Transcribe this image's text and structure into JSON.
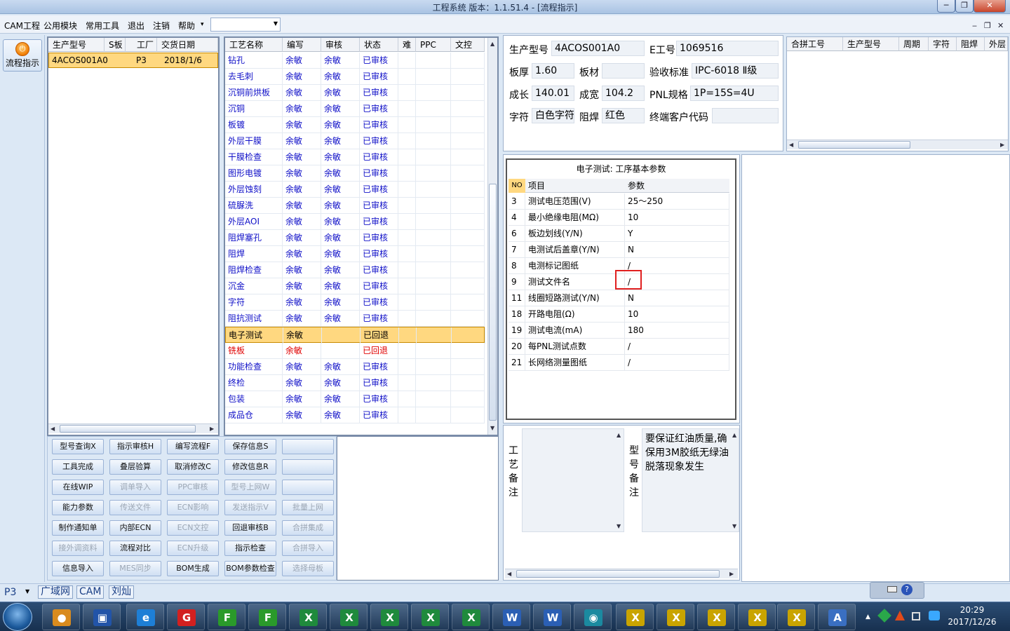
{
  "window": {
    "title": "工程系统   版本：1.1.51.4 - [流程指示]",
    "min_btn": "─",
    "max_btn": "❐",
    "close_btn": "✕"
  },
  "menu": {
    "items": [
      "CAM工程",
      "公用模块",
      "常用工具",
      "退出",
      "注销",
      "帮助"
    ],
    "help_arrow": "▾",
    "combo_value": "",
    "mdi_min": "‒",
    "mdi_restore": "❐",
    "mdi_close": "✕"
  },
  "left_toolbar": {
    "flow_button": "流程指示",
    "flow_icon": "power-icon"
  },
  "order_list": {
    "headers": [
      "生产型号",
      "S板",
      "工厂",
      "交货日期"
    ],
    "rows": [
      {
        "model": "4ACOS001A0",
        "s": "",
        "factory": "P3",
        "date": "2018/1/6"
      }
    ]
  },
  "process_table": {
    "headers": [
      "工艺名称",
      "编写",
      "审核",
      "状态",
      "难",
      "PPC",
      "文控"
    ],
    "rows": [
      {
        "name": "钻孔",
        "writer": "余敏",
        "reviewer": "余敏",
        "status": "已审核"
      },
      {
        "name": "去毛刺",
        "writer": "余敏",
        "reviewer": "余敏",
        "status": "已审核"
      },
      {
        "name": "沉铜前烘板",
        "writer": "余敏",
        "reviewer": "余敏",
        "status": "已审核"
      },
      {
        "name": "沉铜",
        "writer": "余敏",
        "reviewer": "余敏",
        "status": "已审核"
      },
      {
        "name": "板镀",
        "writer": "余敏",
        "reviewer": "余敏",
        "status": "已审核"
      },
      {
        "name": "外层干膜",
        "writer": "余敏",
        "reviewer": "余敏",
        "status": "已审核"
      },
      {
        "name": "干膜检查",
        "writer": "余敏",
        "reviewer": "余敏",
        "status": "已审核"
      },
      {
        "name": "图形电镀",
        "writer": "余敏",
        "reviewer": "余敏",
        "status": "已审核"
      },
      {
        "name": "外层蚀刻",
        "writer": "余敏",
        "reviewer": "余敏",
        "status": "已审核"
      },
      {
        "name": "硫脲洗",
        "writer": "余敏",
        "reviewer": "余敏",
        "status": "已审核"
      },
      {
        "name": "外层AOI",
        "writer": "余敏",
        "reviewer": "余敏",
        "status": "已审核"
      },
      {
        "name": "阻焊塞孔",
        "writer": "余敏",
        "reviewer": "余敏",
        "status": "已审核"
      },
      {
        "name": "阻焊",
        "writer": "余敏",
        "reviewer": "余敏",
        "status": "已审核"
      },
      {
        "name": "阻焊检查",
        "writer": "余敏",
        "reviewer": "余敏",
        "status": "已审核"
      },
      {
        "name": "沉金",
        "writer": "余敏",
        "reviewer": "余敏",
        "status": "已审核"
      },
      {
        "name": "字符",
        "writer": "余敏",
        "reviewer": "余敏",
        "status": "已审核"
      },
      {
        "name": "阻抗测试",
        "writer": "余敏",
        "reviewer": "余敏",
        "status": "已审核"
      },
      {
        "name": "电子测试",
        "writer": "余敏",
        "reviewer": "",
        "status": "已回退"
      },
      {
        "name": "铣板",
        "writer": "余敏",
        "reviewer": "",
        "status": "已回退"
      },
      {
        "name": "功能检查",
        "writer": "余敏",
        "reviewer": "余敏",
        "status": "已审核"
      },
      {
        "name": "终检",
        "writer": "余敏",
        "reviewer": "余敏",
        "status": "已审核"
      },
      {
        "name": "包装",
        "writer": "余敏",
        "reviewer": "余敏",
        "status": "已审核"
      },
      {
        "name": "成品仓",
        "writer": "余敏",
        "reviewer": "余敏",
        "status": "已审核"
      }
    ]
  },
  "actions": [
    [
      "型号查询X",
      "指示审核H",
      "编写流程F",
      "保存信息S",
      ""
    ],
    [
      "工具完成",
      "叠层验算",
      "取消修改C",
      "修改信息R",
      ""
    ],
    [
      "在线WIP",
      "调单导入",
      "PPC审核",
      "型号上网W",
      ""
    ],
    [
      "能力参数",
      "传送文件",
      "ECN影响",
      "发送指示V",
      "批量上网"
    ],
    [
      "制作通知单",
      "内部ECN",
      "ECN文控",
      "回退审核B",
      "合拼集成"
    ],
    [
      "接外调资料",
      "流程对比",
      "ECN升级",
      "指示检查",
      "合拼导入"
    ],
    [
      "信息导入",
      "MES同步",
      "BOM生成",
      "BOM参数检查",
      "选择母板"
    ]
  ],
  "info": {
    "model_label": "生产型号",
    "model": "4ACOS001A0",
    "eno_label": "E工号",
    "eno": "1069516",
    "thickness_label": "板厚",
    "thickness": "1.60",
    "material_label": "板材",
    "material": "",
    "standard_label": "验收标准",
    "standard": "IPC-6018 Ⅱ级",
    "length_label": "成长",
    "length": "140.01",
    "width_label": "成宽",
    "width": "104.2",
    "pnl_label": "PNL规格",
    "pnl": "1P=15S=4U",
    "char_label": "字符",
    "char": "白色字符",
    "mask_label": "阻焊",
    "mask": "红色",
    "customer_label": "终端客户代码",
    "customer": ""
  },
  "merge_table": {
    "headers": [
      "合拼工号",
      "生产型号",
      "周期",
      "字符",
      "阻焊",
      "外层"
    ]
  },
  "params": {
    "title": "电子测试: 工序基本参数",
    "headers": [
      "NO",
      "项目",
      "参数"
    ],
    "rows": [
      {
        "no": "3",
        "item": "测试电压范围(V)",
        "value": "25～250"
      },
      {
        "no": "4",
        "item": "最小绝缘电阻(MΩ)",
        "value": "10"
      },
      {
        "no": "6",
        "item": "板边划线(Y/N)",
        "value": "Y"
      },
      {
        "no": "7",
        "item": "电测试后盖章(Y/N)",
        "value": "N"
      },
      {
        "no": "8",
        "item": "电测标记图纸",
        "value": "/"
      },
      {
        "no": "9",
        "item": "测试文件名",
        "value": "/"
      },
      {
        "no": "11",
        "item": "线圈短路测试(Y/N)",
        "value": "N"
      },
      {
        "no": "18",
        "item": "开路电阻(Ω)",
        "value": "10"
      },
      {
        "no": "19",
        "item": "测试电流(mA)",
        "value": "180"
      },
      {
        "no": "20",
        "item": "每PNL测试点数",
        "value": "/"
      },
      {
        "no": "21",
        "item": "长网络测量图纸",
        "value": "/"
      }
    ],
    "highlight_color": "#e02020"
  },
  "remarks": {
    "process_label": "工艺备注",
    "model_label": "型号备注",
    "process_text": "",
    "model_text": "要保证红油质量,确保用3M胶纸无绿油脱落现象发生"
  },
  "status": {
    "factory": "P3",
    "network": "广域网",
    "dept": "CAM",
    "user": "刘灿"
  },
  "taskbar": {
    "time": "20:29",
    "date": "2017/12/26"
  }
}
